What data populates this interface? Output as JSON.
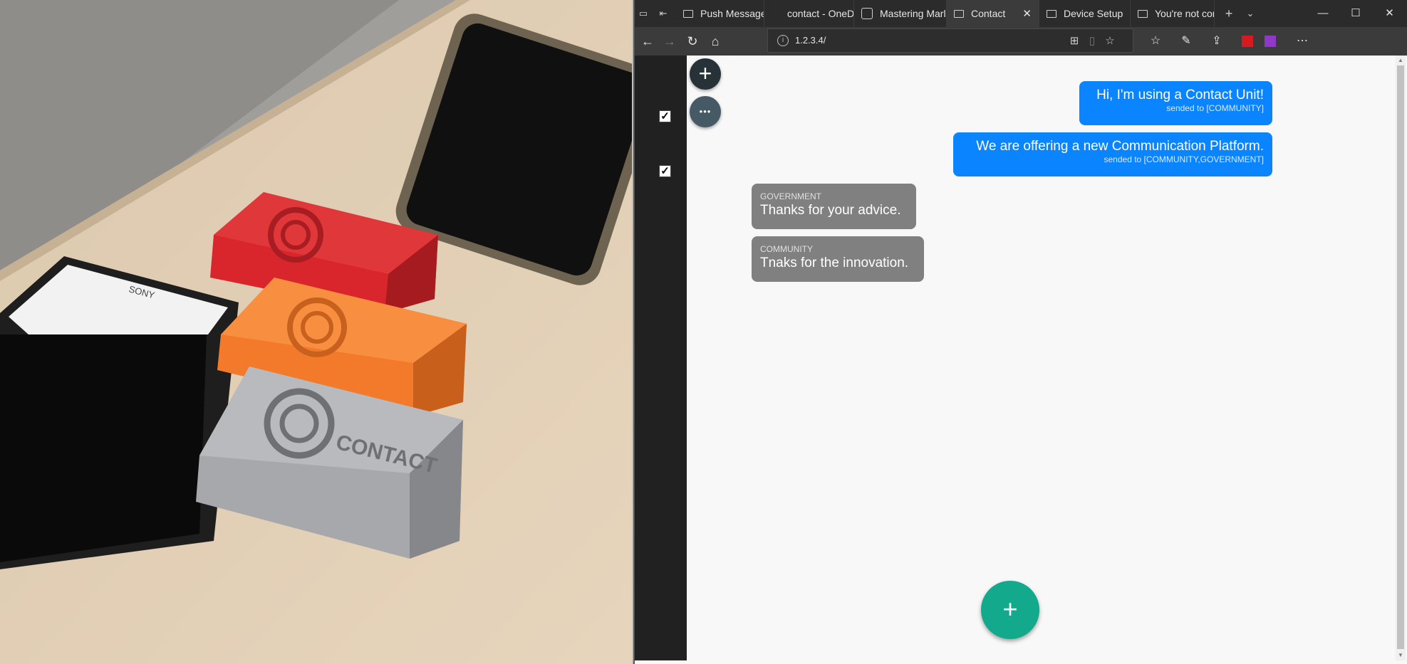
{
  "photo": {
    "brand_text": "SONY",
    "device_label": "CONTACT"
  },
  "browser": {
    "tabs": [
      {
        "label": "Push Messages",
        "icon": "page-icon"
      },
      {
        "label": "contact - OneD",
        "icon": "onedrive-icon"
      },
      {
        "label": "Mastering Marl",
        "icon": "site-icon"
      },
      {
        "label": "Contact",
        "icon": "page-icon",
        "active": true
      },
      {
        "label": "Device Setup",
        "icon": "page-icon"
      },
      {
        "label": "You're not conr",
        "icon": "page-icon"
      }
    ],
    "url": "1.2.3.4/",
    "info_glyph": "i"
  },
  "app": {
    "add_glyph": "+",
    "more_glyph": "•••",
    "check_glyph": "✓",
    "fab_glyph": "+",
    "messages": [
      {
        "direction": "out",
        "text": "Hi, I'm using a Contact Unit!",
        "meta": "sended to [COMMUNITY]"
      },
      {
        "direction": "out",
        "text": "We are offering a new Communication Platform.",
        "meta": "sended to [COMMUNITY,GOVERNMENT]"
      },
      {
        "direction": "in",
        "sender": "GOVERNMENT",
        "text": "Thanks for your advice."
      },
      {
        "direction": "in",
        "sender": "COMMUNITY",
        "text": "Tnaks for the innovation."
      }
    ]
  },
  "colors": {
    "outgoing_bubble": "#0a84ff",
    "incoming_bubble": "#808080",
    "fab": "#12a98d",
    "sidebar": "#212121"
  }
}
